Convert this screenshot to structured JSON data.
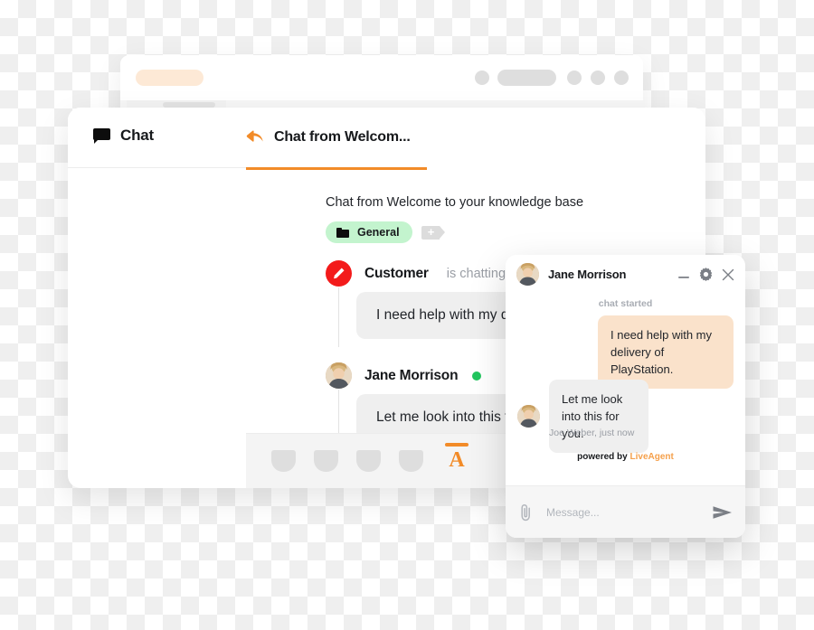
{
  "app_window": {
    "topbar": {
      "orange_pill": "",
      "gray_items": [
        "dot",
        "pill",
        "dot",
        "dot",
        "dot"
      ]
    },
    "sidebar_skeleton_rows": 4
  },
  "chat_panel": {
    "nav": {
      "chat_label": "Chat",
      "chat_icon": "speech-bubble-icon"
    },
    "active_tab": {
      "label": "Chat from Welcom...",
      "icon": "reply-arrow-icon",
      "accent_color": "#f28b28"
    },
    "conversation": {
      "title": "Chat from Welcome to your knowledge base",
      "tag": {
        "label": "General",
        "icon": "folder-icon",
        "background": "#c3f4ce",
        "add_button_icon": "add-tag-icon"
      },
      "messages": [
        {
          "author": "Customer",
          "status": "is chatting...",
          "avatar": "pencil-icon",
          "avatar_color": "#f31b1b",
          "text": "I need help with my delivery"
        },
        {
          "author": "Jane Morrison",
          "status": "",
          "avatar": "agent-photo",
          "online": true,
          "online_color": "#22c55e",
          "text": "Let me look into this for you."
        }
      ]
    },
    "composer": {
      "tool_placeholders": 4,
      "format_label": "A",
      "format_color": "#f28b28"
    }
  },
  "widget": {
    "header": {
      "agent_name": "Jane Morrison",
      "avatar": "agent-photo",
      "icons": [
        "minimize-icon",
        "gear-icon",
        "close-icon"
      ]
    },
    "system_note": "chat started",
    "messages": [
      {
        "side": "customer",
        "text": "I need help with my delivery of PlayStation.",
        "background": "#fae2cb"
      },
      {
        "side": "agent",
        "text": "Let me look into this for you.",
        "background": "#efefef"
      }
    ],
    "meta": "Joe Weber, just now",
    "branding": {
      "prefix": "powered by",
      "name": "LiveAgent",
      "name_color": "#f5a04b"
    },
    "footer": {
      "attach_icon": "paperclip-icon",
      "placeholder": "Message...",
      "value": "",
      "send_icon": "send-icon"
    }
  }
}
